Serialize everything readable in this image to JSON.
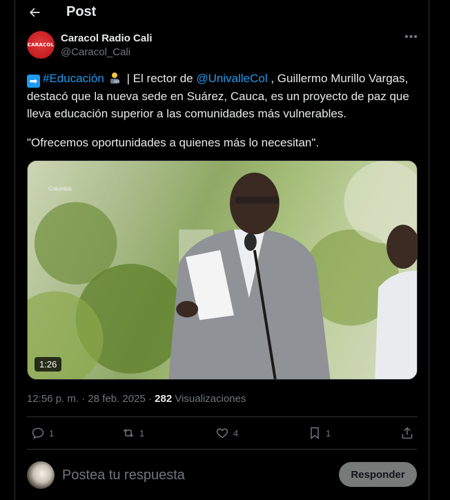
{
  "header": {
    "title": "Post"
  },
  "author": {
    "name": "Caracol Radio Cali",
    "handle": "@Caracol_Cali",
    "logo_text": "CARACOL"
  },
  "tweet": {
    "line1_emoji": "➡",
    "hashtag": "#Educación",
    "line1_mid": " | El rector de ",
    "mention": "@UnivalleCol",
    "line1_end": " , Guillermo Murillo Vargas,",
    "line2": "destacó que la nueva sede en Suárez, Cauca, es un proyecto de paz que",
    "line3": "lleva educación superior a las comunidades más vulnerables.",
    "quote": "\"Ofrecemos oportunidades a quienes más lo necesitan\"."
  },
  "video": {
    "duration": "1:26",
    "watermark": "Colombia"
  },
  "meta": {
    "time": "12:56 p. m.",
    "separator": " · ",
    "date": "28 feb. 2025",
    "views_count": "282",
    "views_label": " Visualizaciones"
  },
  "actions": {
    "replies": "1",
    "reposts": "1",
    "likes": "4",
    "bookmarks": "1"
  },
  "composer": {
    "placeholder": "Postea tu respuesta",
    "button": "Responder"
  },
  "colors": {
    "accent": "#1d9bf0",
    "background": "#000000",
    "muted": "#71767b",
    "border": "#2f3336",
    "brand": "#c41e22"
  }
}
